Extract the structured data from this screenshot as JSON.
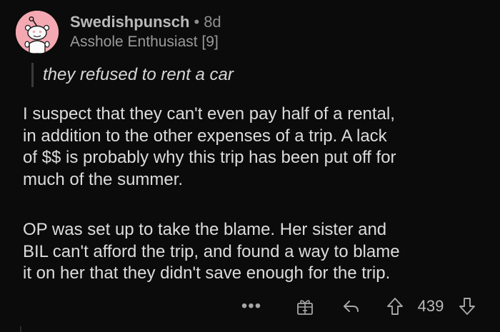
{
  "comment": {
    "username": "Swedishpunsch",
    "separator": "•",
    "age": "8d",
    "flair": "Asshole Enthusiast [9]",
    "quote": "they refused to rent a car",
    "paragraphs": [
      "I suspect that they can't even pay half of a rental,\nin addition to the other expenses of a trip.  A lack\nof $$ is probably why this trip has been put off for\nmuch of the summer.",
      "OP was set up to take the blame.  Her sister and\nBIL can't afford the trip, and found a way to blame\nit on her that they didn't save enough for the trip."
    ],
    "avatar_icon": "reddit-snoo-icon",
    "avatar_color": "#f4a9b2"
  },
  "actions": {
    "more_label": "•••",
    "more_icon": "more-options-icon",
    "award_icon": "gift-award-icon",
    "reply_icon": "reply-arrow-icon",
    "upvote_icon": "upvote-arrow-icon",
    "score": "439",
    "downvote_icon": "downvote-arrow-icon"
  },
  "colors": {
    "background": "#0b0b0b",
    "text": "#dcdcdc",
    "muted": "#8e8e8e",
    "quote_bar": "#3a3a3a"
  }
}
